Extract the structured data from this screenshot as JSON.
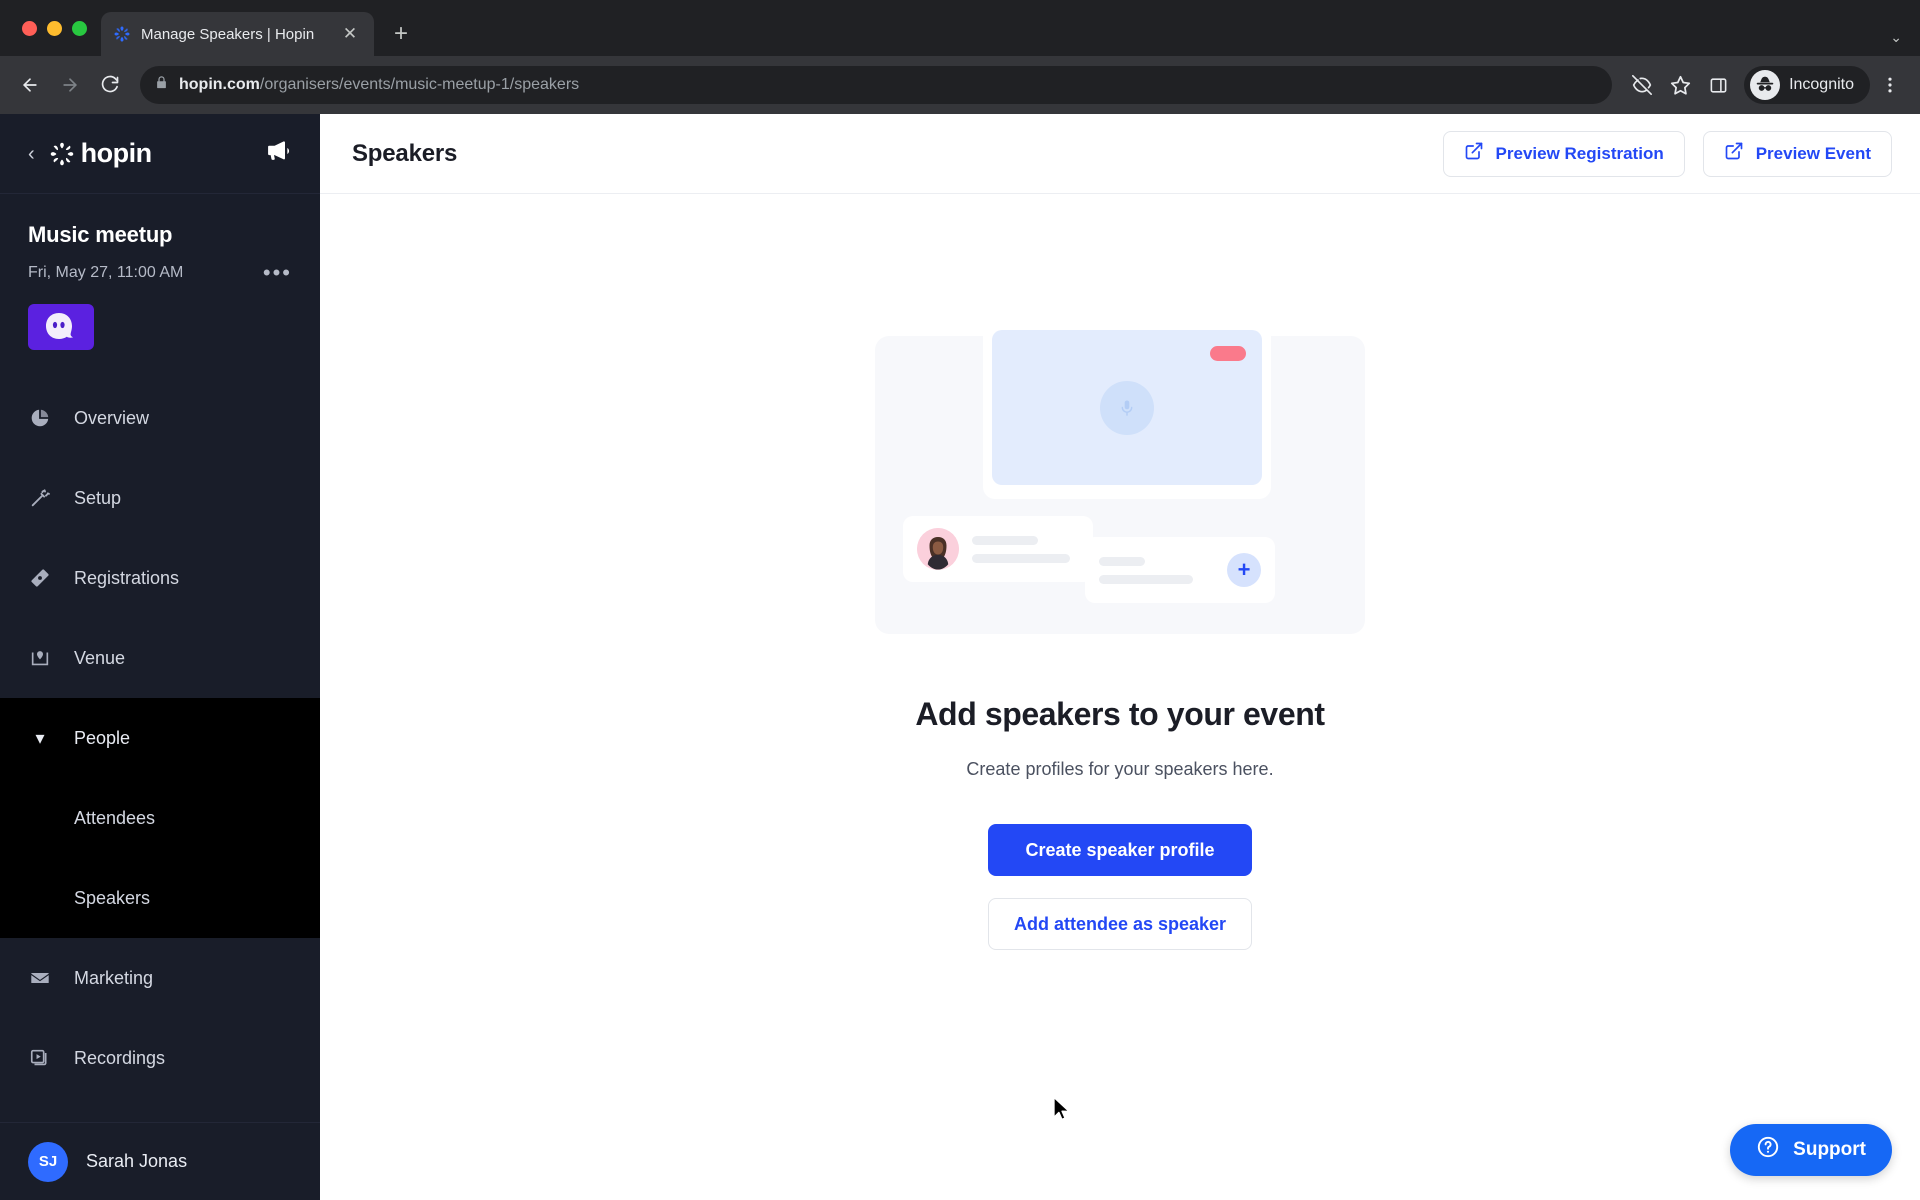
{
  "browser": {
    "tab": {
      "title": "Manage Speakers | Hopin",
      "favicon_name": "hopin-favicon",
      "close_label": "✕"
    },
    "new_tab_label": "+",
    "tabstrip_chevron": "⌄",
    "nav": {
      "back": "←",
      "forward": "→",
      "reload": "↻"
    },
    "omnibox": {
      "lock_icon": "lock-icon",
      "domain": "hopin.com",
      "path": "/organisers/events/music-meetup-1/speakers",
      "full_url": "hopin.com/organisers/events/music-meetup-1/speakers"
    },
    "toolbar_icons": [
      "eye-slash-icon",
      "star-icon",
      "side-panel-icon",
      "kebab-menu-icon"
    ],
    "profile": {
      "label": "Incognito",
      "avatar_icon": "incognito-avatar-icon"
    }
  },
  "sidebar": {
    "back_chevron": "‹",
    "brand": "hopin",
    "announce_icon": "megaphone-icon",
    "event": {
      "name": "Music meetup",
      "date": "Fri, May 27, 11:00 AM",
      "more_label": "•••",
      "thumbnail_name": "event-thumbnail"
    },
    "nav": [
      {
        "label": "Overview",
        "icon": "pie-chart-icon"
      },
      {
        "label": "Setup",
        "icon": "magic-wand-icon"
      },
      {
        "label": "Registrations",
        "icon": "ticket-icon"
      },
      {
        "label": "Venue",
        "icon": "map-pin-icon"
      }
    ],
    "group": {
      "label": "People",
      "caret": "▾",
      "expanded": true,
      "children": [
        {
          "label": "Attendees",
          "active": false
        },
        {
          "label": "Speakers",
          "active": true
        }
      ]
    },
    "nav_after": [
      {
        "label": "Marketing",
        "icon": "envelope-icon"
      },
      {
        "label": "Recordings",
        "icon": "video-library-icon"
      }
    ],
    "user": {
      "initials": "SJ",
      "name": "Sarah Jonas"
    }
  },
  "header": {
    "title": "Speakers",
    "actions": [
      {
        "label": "Preview Registration",
        "icon": "external-link-icon"
      },
      {
        "label": "Preview Event",
        "icon": "external-link-icon"
      }
    ]
  },
  "empty_state": {
    "illustration_name": "speakers-empty-illustration",
    "title": "Add speakers to your event",
    "subtitle": "Create profiles for your speakers here.",
    "primary_button": "Create speaker profile",
    "secondary_button": "Add attendee as speaker"
  },
  "support": {
    "label": "Support",
    "icon": "question-circle-icon"
  },
  "colors": {
    "accent_blue": "#2348f5",
    "support_blue": "#1668f5",
    "sidebar_bg": "#191d29",
    "sidebar_group_bg": "#000000",
    "thumbnail_purple": "#5b21e0",
    "badge_red": "#fa7a8b"
  }
}
